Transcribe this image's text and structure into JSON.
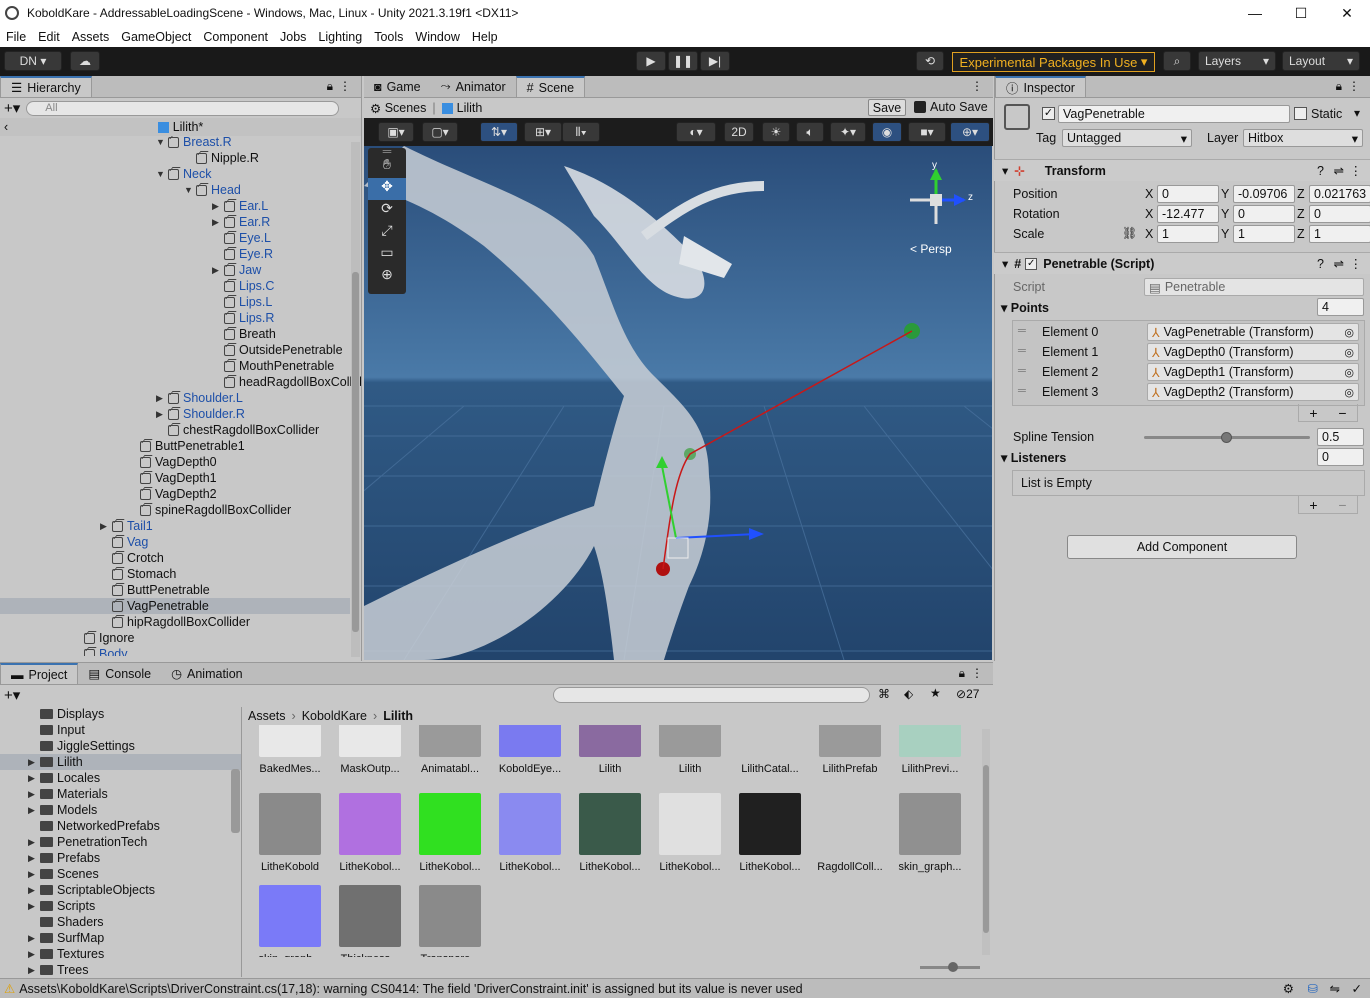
{
  "window": {
    "title": "KoboldKare - AddressableLoadingScene - Windows, Mac, Linux - Unity 2021.3.19f1 <DX11>",
    "min": "—",
    "max": "☐",
    "close": "✕"
  },
  "menu": [
    "File",
    "Edit",
    "Assets",
    "GameObject",
    "Component",
    "Jobs",
    "Lighting",
    "Tools",
    "Window",
    "Help"
  ],
  "toolbar": {
    "account": "DN",
    "experimental": "Experimental Packages In Use",
    "layers": "Layers",
    "layout": "Layout"
  },
  "hierarchy": {
    "tab": "Hierarchy",
    "search_placeholder": "All",
    "root": "Lilith*",
    "rows": [
      {
        "label": "Breast.R",
        "indent": 1,
        "arrow": "down",
        "blue": true
      },
      {
        "label": "Nipple.R",
        "indent": 2,
        "arrow": "",
        "blue": false
      },
      {
        "label": "Neck",
        "indent": 1,
        "arrow": "down",
        "blue": true
      },
      {
        "label": "Head",
        "indent": 2,
        "arrow": "down",
        "blue": true
      },
      {
        "label": "Ear.L",
        "indent": 3,
        "arrow": "right",
        "blue": true
      },
      {
        "label": "Ear.R",
        "indent": 3,
        "arrow": "right",
        "blue": true
      },
      {
        "label": "Eye.L",
        "indent": 3,
        "arrow": "",
        "blue": true
      },
      {
        "label": "Eye.R",
        "indent": 3,
        "arrow": "",
        "blue": true
      },
      {
        "label": "Jaw",
        "indent": 3,
        "arrow": "right",
        "blue": true
      },
      {
        "label": "Lips.C",
        "indent": 3,
        "arrow": "",
        "blue": true
      },
      {
        "label": "Lips.L",
        "indent": 3,
        "arrow": "",
        "blue": true
      },
      {
        "label": "Lips.R",
        "indent": 3,
        "arrow": "",
        "blue": true
      },
      {
        "label": "Breath",
        "indent": 3,
        "arrow": "",
        "blue": false
      },
      {
        "label": "OutsidePenetrable",
        "indent": 3,
        "arrow": "",
        "blue": false
      },
      {
        "label": "MouthPenetrable",
        "indent": 3,
        "arrow": "",
        "blue": false
      },
      {
        "label": "headRagdollBoxCollider",
        "indent": 3,
        "arrow": "",
        "blue": false
      },
      {
        "label": "Shoulder.L",
        "indent": 1,
        "arrow": "right",
        "blue": true
      },
      {
        "label": "Shoulder.R",
        "indent": 1,
        "arrow": "right",
        "blue": true
      },
      {
        "label": "chestRagdollBoxCollider",
        "indent": 1,
        "arrow": "",
        "blue": false
      },
      {
        "label": "ButtPenetrable1",
        "indent": 0,
        "arrow": "",
        "blue": false
      },
      {
        "label": "VagDepth0",
        "indent": 0,
        "arrow": "",
        "blue": false
      },
      {
        "label": "VagDepth1",
        "indent": 0,
        "arrow": "",
        "blue": false
      },
      {
        "label": "VagDepth2",
        "indent": 0,
        "arrow": "",
        "blue": false
      },
      {
        "label": "spineRagdollBoxCollider",
        "indent": 0,
        "arrow": "",
        "blue": false
      },
      {
        "label": "Tail1",
        "indent": -1,
        "arrow": "right",
        "blue": true
      },
      {
        "label": "Vag",
        "indent": -1,
        "arrow": "",
        "blue": true
      },
      {
        "label": "Crotch",
        "indent": -1,
        "arrow": "",
        "blue": false
      },
      {
        "label": "Stomach",
        "indent": -1,
        "arrow": "",
        "blue": false
      },
      {
        "label": "ButtPenetrable",
        "indent": -1,
        "arrow": "",
        "blue": false
      },
      {
        "label": "VagPenetrable",
        "indent": -1,
        "arrow": "",
        "blue": false,
        "selected": true
      },
      {
        "label": "hipRagdollBoxCollider",
        "indent": -1,
        "arrow": "",
        "blue": false
      },
      {
        "label": "Ignore",
        "indent": -2,
        "arrow": "",
        "blue": false
      },
      {
        "label": "Body",
        "indent": -2,
        "arrow": "",
        "blue": true
      }
    ]
  },
  "scene_tabs": {
    "game": "Game",
    "animator": "Animator",
    "scene": "Scene"
  },
  "scene_bar": {
    "scenes": "Scenes",
    "lilith": "Lilith",
    "save": "Save",
    "autosave": "Auto Save",
    "mode2d": "2D",
    "persp": "< Persp",
    "axis_y": "y",
    "axis_z": "z"
  },
  "inspector": {
    "tab": "Inspector",
    "object_name": "VagPenetrable",
    "static": "Static",
    "tag_label": "Tag",
    "tag": "Untagged",
    "layer_label": "Layer",
    "layer": "Hitbox",
    "transform": {
      "title": "Transform",
      "position_label": "Position",
      "rotation_label": "Rotation",
      "scale_label": "Scale",
      "position": {
        "x": "0",
        "y": "-0.09706",
        "z": "0.021763"
      },
      "rotation": {
        "x": "-12.477",
        "y": "0",
        "z": "0"
      },
      "scale": {
        "x": "1",
        "y": "1",
        "z": "1"
      }
    },
    "script_comp": {
      "title": "Penetrable (Script)",
      "script_label": "Script",
      "script": "Penetrable",
      "points_label": "Points",
      "points_count": "4",
      "elements": [
        {
          "label": "Element 0",
          "value": "VagPenetrable (Transform)"
        },
        {
          "label": "Element 1",
          "value": "VagDepth0 (Transform)"
        },
        {
          "label": "Element 2",
          "value": "VagDepth1 (Transform)"
        },
        {
          "label": "Element 3",
          "value": "VagDepth2 (Transform)"
        }
      ],
      "spline_label": "Spline Tension",
      "spline_value": "0.5",
      "spline_fraction": 0.5,
      "listeners_label": "Listeners",
      "listeners_count": "0",
      "list_empty": "List is Empty"
    },
    "add_component": "Add Component"
  },
  "project": {
    "tabs": [
      "Project",
      "Console",
      "Animation"
    ],
    "hidden_count": "27",
    "breadcrumb": [
      "Assets",
      "KoboldKare",
      "Lilith"
    ],
    "folders": [
      {
        "label": "Displays",
        "arrow": false
      },
      {
        "label": "Input",
        "arrow": false
      },
      {
        "label": "JiggleSettings",
        "arrow": false
      },
      {
        "label": "Lilith",
        "arrow": true,
        "selected": true
      },
      {
        "label": "Locales",
        "arrow": true
      },
      {
        "label": "Materials",
        "arrow": true
      },
      {
        "label": "Models",
        "arrow": true
      },
      {
        "label": "NetworkedPrefabs",
        "arrow": false
      },
      {
        "label": "PenetrationTech",
        "arrow": true
      },
      {
        "label": "Prefabs",
        "arrow": true
      },
      {
        "label": "Scenes",
        "arrow": true
      },
      {
        "label": "ScriptableObjects",
        "arrow": true
      },
      {
        "label": "Scripts",
        "arrow": true
      },
      {
        "label": "Shaders",
        "arrow": false
      },
      {
        "label": "SurfMap",
        "arrow": true
      },
      {
        "label": "Textures",
        "arrow": true
      },
      {
        "label": "Trees",
        "arrow": true
      }
    ],
    "assets": [
      {
        "label": "BakedMes...",
        "color": "#e8e8e8"
      },
      {
        "label": "MaskOutp...",
        "color": "#e8e8e8"
      },
      {
        "label": "Animatabl...",
        "color": "#9a9a9a"
      },
      {
        "label": "KoboldEye...",
        "color": "#7a7af0"
      },
      {
        "label": "Lilith",
        "color": "#8a6aa0"
      },
      {
        "label": "Lilith",
        "color": "#9a9a9a"
      },
      {
        "label": "LilithCatal...",
        "color": "#c8c8c8"
      },
      {
        "label": "LilithPrefab",
        "color": "#9a9a9a"
      },
      {
        "label": "LilithPrevi...",
        "color": "#a8d0c0"
      },
      {
        "label": "LitheKobold",
        "color": "#8a8a8a"
      },
      {
        "label": "LitheKobol...",
        "color": "#b070e0"
      },
      {
        "label": "LitheKobol...",
        "color": "#30e020"
      },
      {
        "label": "LitheKobol...",
        "color": "#8a8af0"
      },
      {
        "label": "LitheKobol...",
        "color": "#3a5a4a"
      },
      {
        "label": "LitheKobol...",
        "color": "#e0e0e0"
      },
      {
        "label": "LitheKobol...",
        "color": "#202020"
      },
      {
        "label": "RagdollColl...",
        "color": "#c8c8c8"
      },
      {
        "label": "skin_graph...",
        "color": "#909090"
      },
      {
        "label": "skin_graph...",
        "color": "#7a7af8"
      },
      {
        "label": "Thickness...",
        "color": "#707070"
      },
      {
        "label": "Transpare...",
        "color": "#8a8a8a"
      }
    ]
  },
  "status": {
    "message": "Assets\\KoboldKare\\Scripts\\DriverConstraint.cs(17,18): warning CS0414: The field 'DriverConstraint.init' is assigned but its value is never used"
  }
}
